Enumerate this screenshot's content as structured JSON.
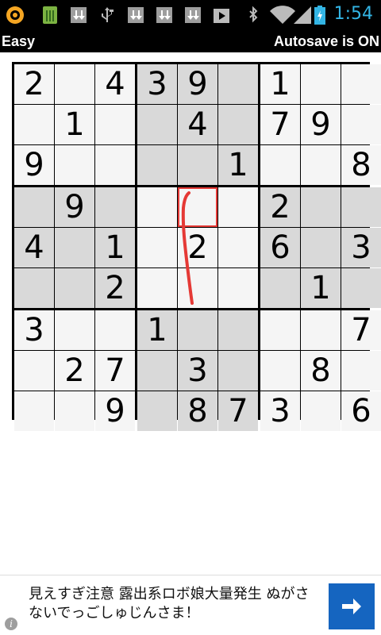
{
  "status_bar": {
    "time": "1:54",
    "icons": [
      "app-icon",
      "trash-icon",
      "download-icon",
      "usb-icon",
      "download-icon",
      "download-icon",
      "download-icon",
      "play-store-icon",
      "bluetooth-icon",
      "wifi-icon",
      "signal-icon",
      "battery-icon"
    ],
    "accent_color": "#33b5e5"
  },
  "title_bar": {
    "difficulty": "Easy",
    "autosave": "Autosave is ON"
  },
  "board": {
    "rows": [
      [
        "2",
        "",
        "4",
        "3",
        "9",
        "",
        "1",
        "",
        ""
      ],
      [
        "",
        "1",
        "",
        "",
        "4",
        "",
        "7",
        "9",
        ""
      ],
      [
        "9",
        "",
        "",
        "",
        "",
        "1",
        "",
        "",
        "8"
      ],
      [
        "",
        "9",
        "",
        "",
        "",
        "",
        "2",
        "",
        ""
      ],
      [
        "4",
        "",
        "1",
        "",
        "2",
        "",
        "6",
        "",
        "3"
      ],
      [
        "",
        "",
        "2",
        "",
        "",
        "",
        "",
        "1",
        ""
      ],
      [
        "3",
        "",
        "",
        "1",
        "",
        "",
        "",
        "",
        "7"
      ],
      [
        "",
        "2",
        "7",
        "",
        "3",
        "",
        "",
        "8",
        ""
      ],
      [
        "",
        "",
        "9",
        "",
        "8",
        "7",
        "3",
        "",
        "6"
      ]
    ],
    "selected_cell": {
      "row": 3,
      "col": 4
    },
    "selection_color": "#e53935",
    "shade_light": "#f5f5f5",
    "shade_dark": "#d9d9d9"
  },
  "ad": {
    "text": "見えすぎ注意 露出系ロボ娘大量発生 ぬがさないでっごしゅじんさま！",
    "button_color": "#1565c0",
    "button_icon": "arrow-right-icon",
    "info_icon": "info-icon",
    "info_glyph": "i"
  }
}
